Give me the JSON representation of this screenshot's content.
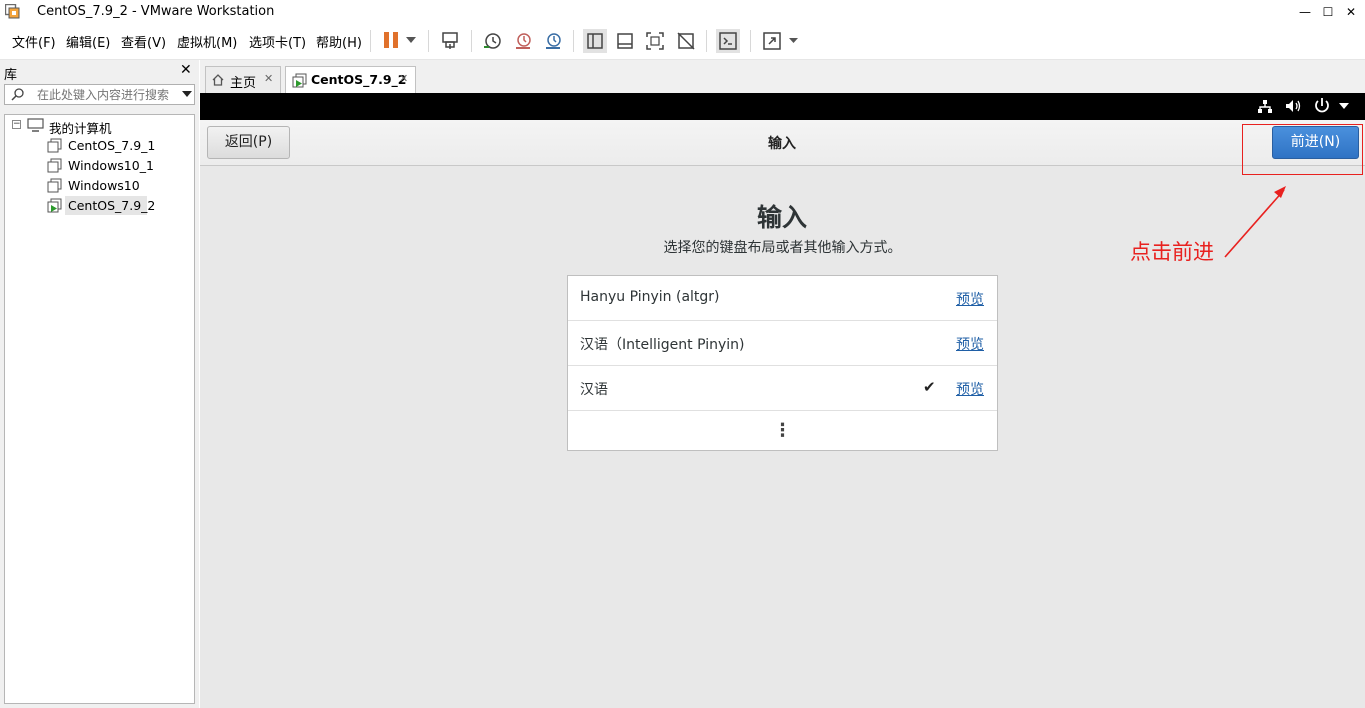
{
  "window": {
    "title": "CentOS_7.9_2 - VMware Workstation",
    "minimize": "—",
    "maximize": "☐",
    "close": "✕"
  },
  "menu": {
    "items": [
      "文件(F)",
      "编辑(E)",
      "查看(V)",
      "虚拟机(M)",
      "选项卡(T)",
      "帮助(H)"
    ]
  },
  "toolbar": {
    "icons": [
      "pause-icon",
      "dropdown-icon",
      "send-keys-icon",
      "snapshot-icon",
      "revert-snapshot-icon",
      "snapshot-manager-icon",
      "sidebar-toggle-icon",
      "thumbnail-bar-icon",
      "fullscreen-icon",
      "unity-icon",
      "console-icon",
      "stretch-icon",
      "dropdown-icon"
    ],
    "accent": "#e0712b"
  },
  "library": {
    "title": "库",
    "close": "✕",
    "search_placeholder": "在此处键入内容进行搜索",
    "tree": {
      "root": "我的计算机",
      "items": [
        "CentOS_7.9_1",
        "Windows10_1",
        "Windows10",
        "CentOS_7.9_2"
      ],
      "selected": "CentOS_7.9_2"
    }
  },
  "tabs": [
    {
      "label": "主页",
      "close": "✕"
    },
    {
      "label": "CentOS_7.9_2",
      "close": "✕",
      "active": true
    }
  ],
  "guest": {
    "back_label": "返回(P)",
    "header_title": "输入",
    "next_label": "前进(N)",
    "heading": "输入",
    "subtitle": "选择您的键盘布局或者其他输入方式。",
    "inputs": [
      {
        "label": "Hanyu Pinyin (altgr)",
        "link": "预览",
        "checked": false
      },
      {
        "label": "汉语（Intelligent Pinyin)",
        "link": "预览",
        "checked": false
      },
      {
        "label": "汉语",
        "link": "预览",
        "checked": true
      }
    ],
    "more": "⋮",
    "check": "✔",
    "accent": "#3a83d6"
  },
  "annotation": {
    "text": "点击前进",
    "color": "#e8211f"
  }
}
